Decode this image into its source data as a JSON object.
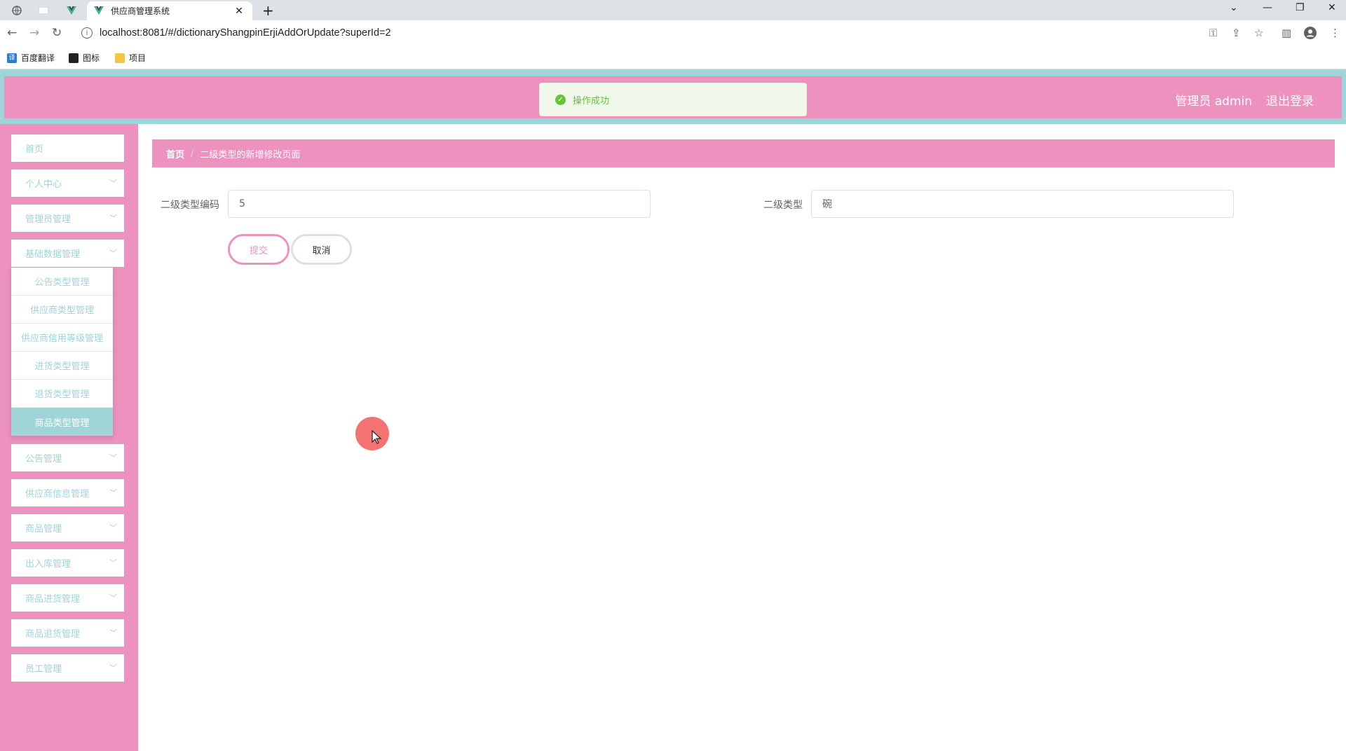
{
  "browser": {
    "tab_title": "供应商管理系统",
    "url": "localhost:8081/#/dictionaryShangpinErjiAddOrUpdate?superId=2",
    "bookmarks": [
      "百度翻译",
      "图标",
      "项目"
    ]
  },
  "header": {
    "user_label": "管理员 admin",
    "logout_label": "退出登录"
  },
  "toast": {
    "message": "操作成功"
  },
  "sidebar": {
    "items": [
      {
        "label": "首页",
        "has_arrow": false
      },
      {
        "label": "个人中心",
        "has_arrow": true
      },
      {
        "label": "管理员管理",
        "has_arrow": true
      },
      {
        "label": "基础数据管理",
        "has_arrow": true
      },
      {
        "label": "公告管理",
        "has_arrow": true
      },
      {
        "label": "供应商信息管理",
        "has_arrow": true
      },
      {
        "label": "商品管理",
        "has_arrow": true
      },
      {
        "label": "出入库管理",
        "has_arrow": true
      },
      {
        "label": "商品进货管理",
        "has_arrow": true
      },
      {
        "label": "商品退货管理",
        "has_arrow": true
      },
      {
        "label": "员工管理",
        "has_arrow": true
      }
    ],
    "submenu": [
      {
        "label": "公告类型管理",
        "active": false
      },
      {
        "label": "供应商类型管理",
        "active": false
      },
      {
        "label": "供应商信用等级管理",
        "active": false
      },
      {
        "label": "进货类型管理",
        "active": false
      },
      {
        "label": "退货类型管理",
        "active": false
      },
      {
        "label": "商品类型管理",
        "active": true
      }
    ]
  },
  "breadcrumb": {
    "home": "首页",
    "current": "二级类型的新增修改页面"
  },
  "form": {
    "code_label": "二级类型编码",
    "code_value": "5",
    "type_label": "二级类型",
    "type_value": "碗",
    "submit_label": "提交",
    "cancel_label": "取消"
  },
  "colors": {
    "pink": "#ed92be",
    "teal": "#9fd4d8",
    "success": "#67c23a"
  }
}
